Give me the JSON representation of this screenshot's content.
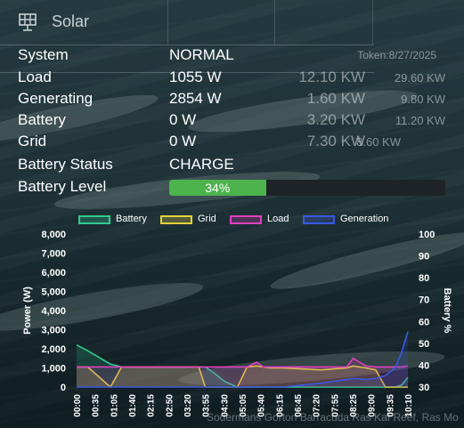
{
  "app": {
    "title": "Solar",
    "token": "Token:8/27/2025",
    "watermark": "Sodermans Gorton Barracuda Ras Kaf Reef, Ras Mo"
  },
  "rows": [
    {
      "label": "System",
      "value": "NORMAL",
      "col1": "",
      "col2": ""
    },
    {
      "label": "Load",
      "value": "1055 W",
      "col1": "12.10 KW",
      "col2": "29.60 KW"
    },
    {
      "label": "Generating",
      "value": "2854 W",
      "col1": "1.60 KW",
      "col2": "9.80 KW"
    },
    {
      "label": "Battery",
      "value": "0 W",
      "col1": "3.20 KW",
      "col2": "11.20 KW"
    },
    {
      "label": "Grid",
      "value": "0 W",
      "col1": "7.30 KW",
      "col2": "8.60 KW"
    },
    {
      "label": "Battery Status",
      "value": "CHARGE",
      "col1": "",
      "col2": ""
    }
  ],
  "battery_level": {
    "label": "Battery Level",
    "text": "34%",
    "percent": 34,
    "color": "#4db34d"
  },
  "chart_data": {
    "type": "line",
    "legend": [
      {
        "name": "Battery",
        "color": "#2ecc8f"
      },
      {
        "name": "Grid",
        "color": "#e6d23a"
      },
      {
        "name": "Load",
        "color": "#e040c0"
      },
      {
        "name": "Generation",
        "color": "#3a58e0"
      }
    ],
    "ylabel": "Power (W)",
    "y2label": "Battery %",
    "ylim": [
      0,
      8000
    ],
    "y2lim": [
      30,
      100
    ],
    "yticks": [
      "8,000",
      "7,000",
      "6,000",
      "5,000",
      "4,000",
      "3,000",
      "2,000",
      "1,000",
      "0"
    ],
    "y2ticks": [
      "100",
      "90",
      "80",
      "70",
      "60",
      "50",
      "40",
      "30"
    ],
    "xticks": [
      "00:00",
      "00:35",
      "01:05",
      "01:40",
      "02:15",
      "02:50",
      "03:20",
      "03:55",
      "04:30",
      "05:05",
      "05:40",
      "06:15",
      "06:45",
      "07:20",
      "07:55",
      "08:25",
      "09:00",
      "09:35",
      "10:10"
    ],
    "x": [
      0,
      0.35,
      1.05,
      1.4,
      2.15,
      2.7,
      3.3,
      3.8,
      4.0,
      4.3,
      4.6,
      5.0,
      5.3,
      5.6,
      5.8,
      6.0,
      6.4,
      7.0,
      7.6,
      8.0,
      8.4,
      8.6,
      9.0,
      9.3,
      9.6,
      9.9,
      10.1,
      10.3
    ],
    "series": [
      {
        "name": "Battery",
        "values": [
          2200,
          1900,
          1200,
          1050,
          1050,
          1050,
          1050,
          1050,
          1050,
          700,
          300,
          0,
          0,
          0,
          0,
          0,
          0,
          0,
          0,
          0,
          0,
          0,
          0,
          0,
          0,
          0,
          100,
          500
        ]
      },
      {
        "name": "Grid",
        "values": [
          1050,
          1050,
          0,
          1050,
          1050,
          1050,
          1050,
          1050,
          0,
          0,
          0,
          0,
          1050,
          1100,
          1050,
          1000,
          1000,
          950,
          900,
          950,
          1000,
          1100,
          1000,
          900,
          0,
          0,
          0,
          0
        ]
      },
      {
        "name": "Load",
        "values": [
          1050,
          1050,
          1050,
          1050,
          1050,
          1050,
          1050,
          1050,
          1050,
          1050,
          1050,
          1050,
          1050,
          1300,
          1050,
          1050,
          1050,
          1050,
          1050,
          1050,
          1050,
          1500,
          1100,
          1050,
          1050,
          1050,
          1050,
          1100
        ]
      },
      {
        "name": "Generation",
        "values": [
          0,
          0,
          0,
          0,
          0,
          0,
          0,
          0,
          0,
          0,
          0,
          0,
          0,
          0,
          0,
          0,
          0,
          100,
          200,
          300,
          400,
          450,
          400,
          450,
          600,
          1000,
          1800,
          2900
        ]
      }
    ]
  }
}
